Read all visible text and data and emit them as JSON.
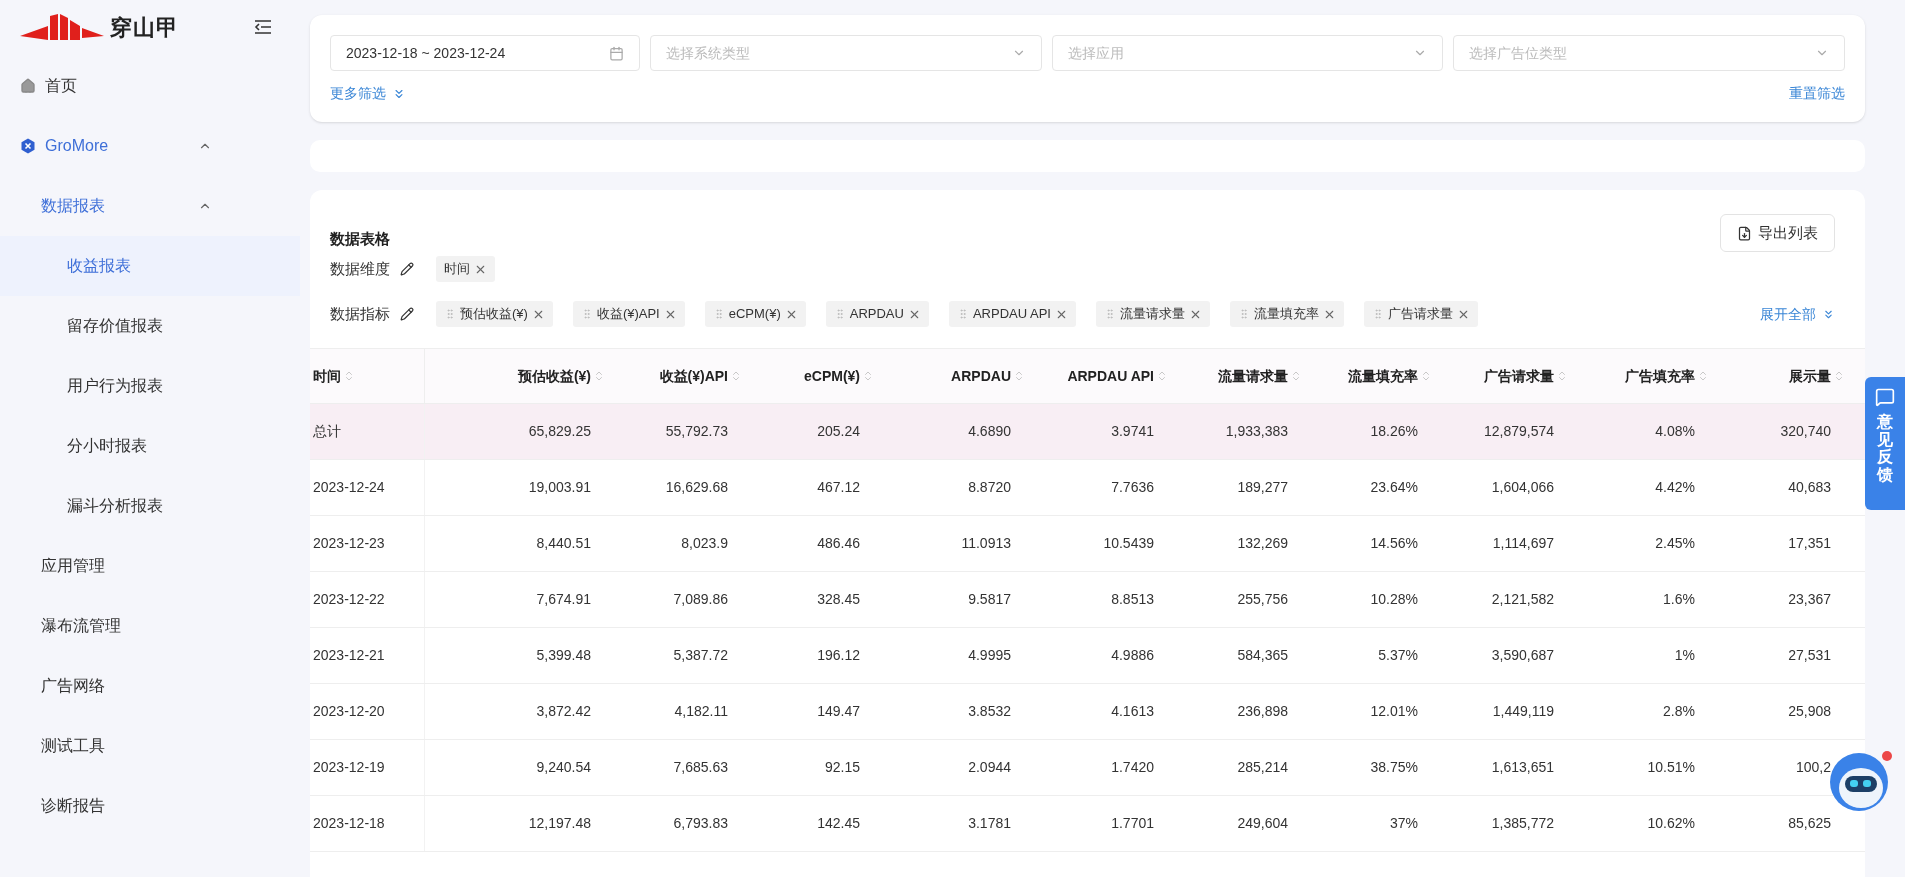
{
  "logo": {
    "text": "穿山甲"
  },
  "sidebar": {
    "items": [
      {
        "label": "首页",
        "selected": false
      },
      {
        "label": "GroMore",
        "expanded": true,
        "children": [
          {
            "label": "数据报表",
            "expanded": true,
            "children": [
              {
                "label": "收益报表",
                "selected": true
              },
              {
                "label": "留存价值报表",
                "selected": false
              },
              {
                "label": "用户行为报表",
                "selected": false
              },
              {
                "label": "分小时报表",
                "selected": false
              },
              {
                "label": "漏斗分析报表",
                "selected": false
              }
            ]
          },
          {
            "label": "应用管理",
            "selected": false
          },
          {
            "label": "瀑布流管理",
            "selected": false
          },
          {
            "label": "广告网络",
            "selected": false
          },
          {
            "label": "测试工具",
            "selected": false
          },
          {
            "label": "诊断报告",
            "selected": false
          }
        ]
      }
    ]
  },
  "filters": {
    "date_range": "2023-12-18 ~ 2023-12-24",
    "selects": [
      {
        "placeholder": "选择系统类型"
      },
      {
        "placeholder": "选择应用"
      },
      {
        "placeholder": "选择广告位类型"
      }
    ],
    "more_filters": "更多筛选",
    "reset": "重置筛选"
  },
  "table_card": {
    "title": "数据表格",
    "export_button": "导出列表",
    "dimensions": {
      "label": "数据维度",
      "tags": [
        "时间"
      ]
    },
    "metrics": {
      "label": "数据指标",
      "tags": [
        "预估收益(¥)",
        "收益(¥)API",
        "eCPM(¥)",
        "ARPDAU",
        "ARPDAU API",
        "流量请求量",
        "流量填充率",
        "广告请求量"
      ]
    },
    "expand_all": "展开全部"
  },
  "table": {
    "columns": [
      "时间",
      "预估收益(¥)",
      "收益(¥)API",
      "eCPM(¥)",
      "ARPDAU",
      "ARPDAU API",
      "流量请求量",
      "流量填充率",
      "广告请求量",
      "广告填充率",
      "展示量"
    ],
    "rows": [
      {
        "highlighted": true,
        "cells": [
          "总计",
          "65,829.25",
          "55,792.73",
          "205.24",
          "4.6890",
          "3.9741",
          "1,933,383",
          "18.26%",
          "12,879,574",
          "4.08%",
          "320,740"
        ]
      },
      {
        "highlighted": false,
        "cells": [
          "2023-12-24",
          "19,003.91",
          "16,629.68",
          "467.12",
          "8.8720",
          "7.7636",
          "189,277",
          "23.64%",
          "1,604,066",
          "4.42%",
          "40,683"
        ]
      },
      {
        "highlighted": false,
        "cells": [
          "2023-12-23",
          "8,440.51",
          "8,023.9",
          "486.46",
          "11.0913",
          "10.5439",
          "132,269",
          "14.56%",
          "1,114,697",
          "2.45%",
          "17,351"
        ]
      },
      {
        "highlighted": false,
        "cells": [
          "2023-12-22",
          "7,674.91",
          "7,089.86",
          "328.45",
          "9.5817",
          "8.8513",
          "255,756",
          "10.28%",
          "2,121,582",
          "1.6%",
          "23,367"
        ]
      },
      {
        "highlighted": false,
        "cells": [
          "2023-12-21",
          "5,399.48",
          "5,387.72",
          "196.12",
          "4.9995",
          "4.9886",
          "584,365",
          "5.37%",
          "3,590,687",
          "1%",
          "27,531"
        ]
      },
      {
        "highlighted": false,
        "cells": [
          "2023-12-20",
          "3,872.42",
          "4,182.11",
          "149.47",
          "3.8532",
          "4.1613",
          "236,898",
          "12.01%",
          "1,449,119",
          "2.8%",
          "25,908"
        ]
      },
      {
        "highlighted": false,
        "cells": [
          "2023-12-19",
          "9,240.54",
          "7,685.63",
          "92.15",
          "2.0944",
          "1.7420",
          "285,214",
          "38.75%",
          "1,613,651",
          "10.51%",
          "100,2"
        ]
      },
      {
        "highlighted": false,
        "cells": [
          "2023-12-18",
          "12,197.48",
          "6,793.83",
          "142.45",
          "3.1781",
          "1.7701",
          "249,604",
          "37%",
          "1,385,772",
          "10.62%",
          "85,625"
        ]
      }
    ]
  },
  "feedback": {
    "label": "意见反馈"
  }
}
